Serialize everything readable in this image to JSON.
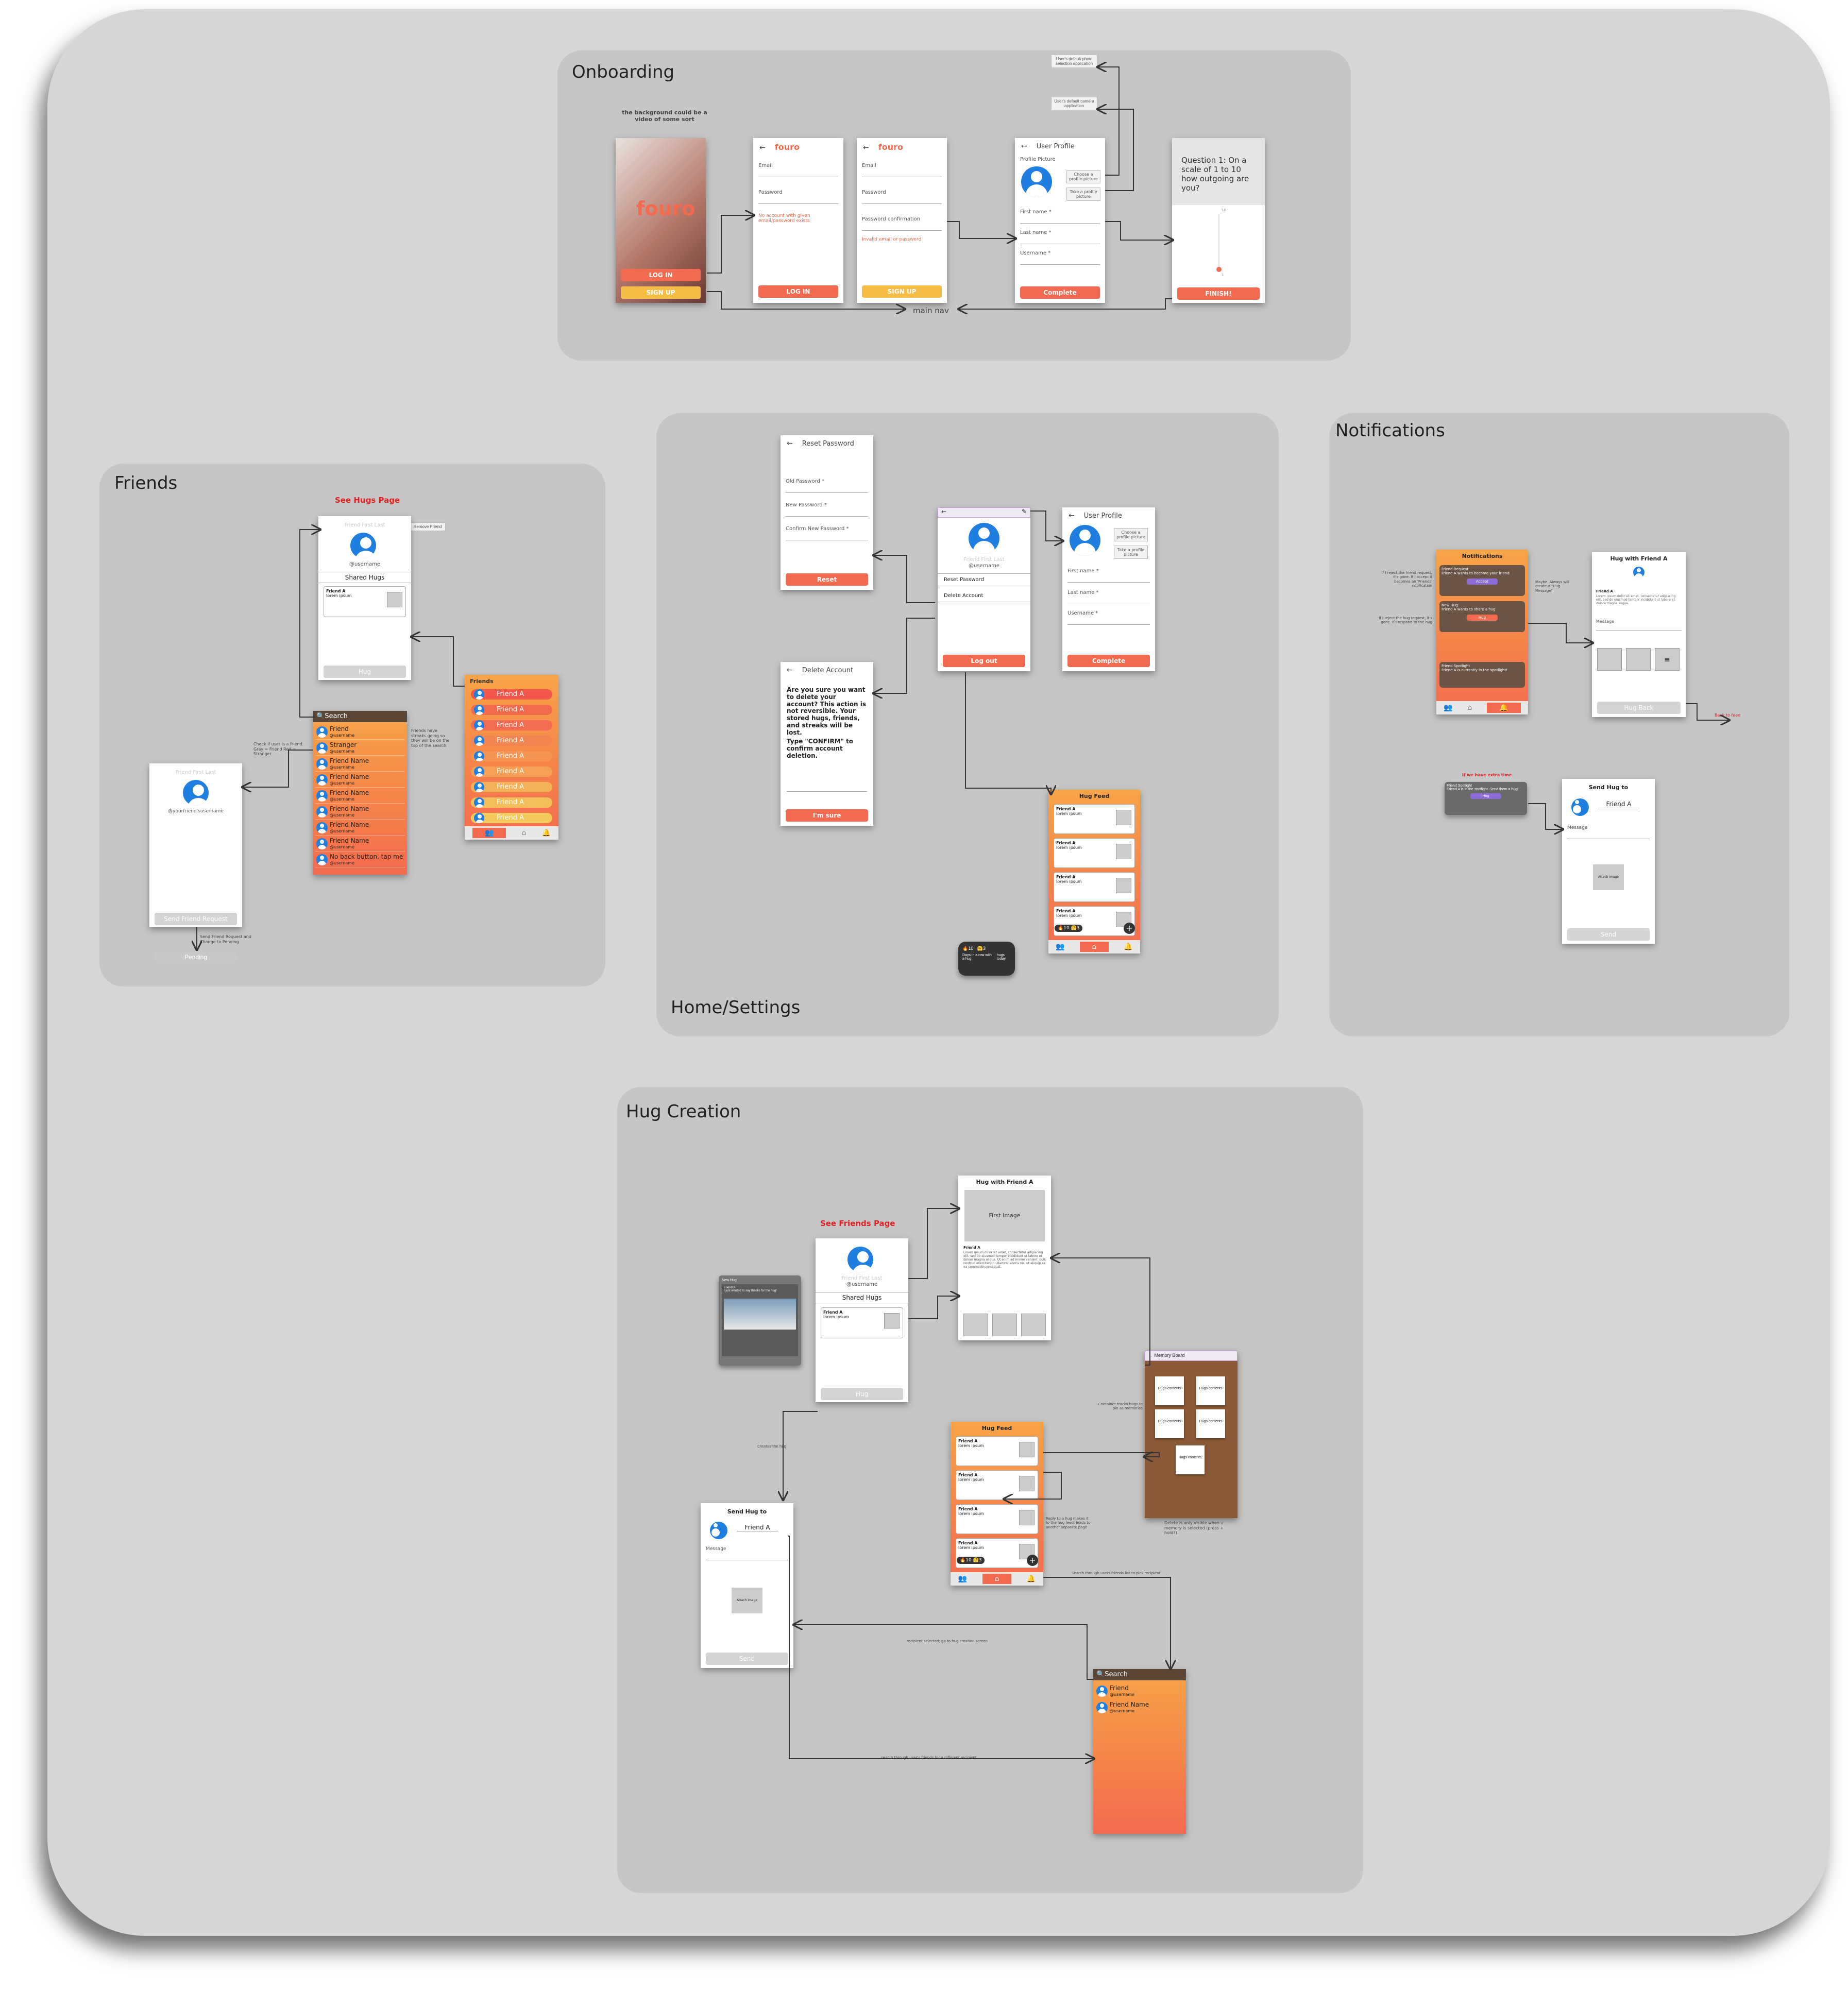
{
  "sections": {
    "onboarding": "Onboarding",
    "friends": "Friends",
    "home_settings": "Home/Settings",
    "notifications": "Notifications",
    "hug_creation": "Hug Creation"
  },
  "onboarding": {
    "bg_note": "the background could be a video of some sort",
    "splash_logo": "fouro",
    "splash_login": "LOG IN",
    "splash_signup": "SIGN UP",
    "login": {
      "logo": "fouro",
      "email": "Email",
      "password": "Password",
      "error": "No account with given email/password exists",
      "button": "LOG IN"
    },
    "signup": {
      "logo": "fouro",
      "email": "Email",
      "password": "Password",
      "confirm": "Password confirmation",
      "error": "Invalid email or password",
      "button": "SIGN UP"
    },
    "profile": {
      "title": "User Profile",
      "picture": "Profile Picture",
      "choose": "Choose a profile picture",
      "take": "Take a profile picture",
      "first": "First name *",
      "last": "Last name *",
      "username": "Username *",
      "button": "Complete"
    },
    "tag_gallery": "User's default photo selection application",
    "tag_camera": "User's default camera application",
    "question": {
      "text": "Question 1: On a scale of 1 to 10 how outgoing are you?",
      "button": "FINISH!",
      "scale_top": "10",
      "scale_bottom": "1"
    },
    "main_nav": "main nav"
  },
  "friends": {
    "see_hugs": "See Hugs Page",
    "remove_friend": "Remove Friend",
    "profile": {
      "name": "Friend First Last",
      "username": "@username",
      "shared": "Shared Hugs",
      "hug_name": "Friend A",
      "hug_text": "lorem ipsum",
      "button": "Hug"
    },
    "search": {
      "placeholder": "Search",
      "rows": [
        {
          "name": "Friend",
          "user": "@username"
        },
        {
          "name": "Stranger",
          "user": "@username"
        },
        {
          "name": "Friend Name",
          "user": "@username"
        },
        {
          "name": "Friend Name",
          "user": "@username"
        },
        {
          "name": "Friend Name",
          "user": "@username"
        },
        {
          "name": "Friend Name",
          "user": "@username"
        },
        {
          "name": "Friend Name",
          "user": "@username"
        },
        {
          "name": "Friend Name",
          "user": "@username"
        },
        {
          "name": "No back button, tap me",
          "user": "@username"
        }
      ]
    },
    "list": {
      "title": "Friends",
      "items": [
        "Friend A",
        "Friend A",
        "Friend A",
        "Friend A",
        "Friend A",
        "Friend A",
        "Friend A",
        "Friend A",
        "Friend A"
      ]
    },
    "stranger": {
      "name": "Friend First Last",
      "username": "@yourfriend'susername",
      "button": "Send Friend Request",
      "pending": "Pending"
    },
    "note_stranger": "Check if user is a friend. Gray = Friend Red = Stranger",
    "note_streak": "Friends have streaks going so they will be on the top of the search",
    "note_request": "Send Friend Request and Change to Pending"
  },
  "home": {
    "reset": {
      "title": "Reset Password",
      "old": "Old Password *",
      "new": "New Password *",
      "confirm": "Confirm New Password *",
      "button": "Reset"
    },
    "delete": {
      "title": "Delete Account",
      "text": "Are you sure you want to delete your account? This action is not reversible. Your stored hugs, friends, and streaks will be lost.",
      "confirm_text": "Type \"CONFIRM\" to confirm account deletion.",
      "button": "I'm sure"
    },
    "settings": {
      "name": "Friend First Last",
      "username": "@username",
      "reset": "Reset Password",
      "delete": "Delete Account",
      "button": "Log out"
    },
    "edit_profile": {
      "title": "User Profile",
      "choose": "Choose a profile picture",
      "take": "Take a profile picture",
      "first": "First name *",
      "last": "Last name *",
      "username": "Username *",
      "button": "Complete"
    },
    "feed": {
      "title": "Hug Feed",
      "items": [
        {
          "name": "Friend A",
          "text": "lorem ipsum"
        },
        {
          "name": "Friend A",
          "text": "lorem ipsum"
        },
        {
          "name": "Friend A",
          "text": "lorem ipsum"
        },
        {
          "name": "Friend A",
          "text": "lorem ipsum"
        }
      ],
      "streak": "10",
      "hugs": "3"
    },
    "tooltip": {
      "streak": "10",
      "hugs": "3",
      "streak_label": "Days in a row with a hug",
      "hugs_label": "hugs today"
    }
  },
  "notifications": {
    "panel": {
      "title": "Notifications",
      "fr_title": "Friend Request",
      "fr_text": "Friend A wants to become your friend",
      "fr_button": "Accept",
      "hug_title": "New Hug",
      "hug_text": "Friend A wants to share a hug",
      "hug_button": "Hug",
      "spot_title": "Friend Spotlight",
      "spot_text": "Friend A is currently in the spotlight!"
    },
    "hug_with": {
      "title": "Hug with Friend A",
      "label": "Friend A",
      "body": "Lorem ipsum dolor sit amet, consectetur adipiscing elit, sed do eiusmod tempor incididunt ut labore et dolore magna aliqua.",
      "message": "Message",
      "button": "Hug Back"
    },
    "note_accept": "If I reject the friend request, it's gone. If I accept it becomes an 'Friends' notification",
    "note_hug": "If I reject the hug request, it's gone. If I respond to the hug",
    "note_message": "Maybe, Always will create a \"Hug Message\"",
    "back_to_feed": "Back to feed",
    "spotlight_note": "If we have extra time",
    "spot_card": {
      "title": "Friend Spotlight",
      "text": "Friend A is in the spotlight. Send them a hug!",
      "button": "Hug"
    },
    "send": {
      "title": "Send Hug to",
      "friend": "Friend A",
      "message": "Message",
      "image": "Attach image",
      "button": "Send"
    }
  },
  "hug_creation": {
    "see_friends": "See Friends Page",
    "new_hug": {
      "title": "New Hug",
      "name": "Friend A",
      "text": "I just wanted to say thanks for the hug!"
    },
    "friend_profile": {
      "name": "Friend First Last",
      "username": "@username",
      "shared": "Shared Hugs",
      "hug_name": "Friend A",
      "hug_text": "lorem ipsum",
      "button": "Hug"
    },
    "hug_view": {
      "title": "Hug with Friend A",
      "image": "First Image",
      "label": "Friend A",
      "body": "Lorem ipsum dolor sit amet, consectetur adipiscing elit, sed do eiusmod tempor incididunt ut labore et dolore magna aliqua. Ut enim ad minim veniam, quis nostrud exercitation ullamco laboris nisi ut aliquip ex ea commodo consequat."
    },
    "memory": {
      "title": "Memory Board",
      "items": [
        "Hugs contents",
        "Hugs contents",
        "Hugs contents",
        "Hugs contents",
        "Hugs contents"
      ],
      "note": "Delete is only visible when a memory is selected (press + hold?)"
    },
    "feed": {
      "title": "Hug Feed",
      "items": [
        {
          "name": "Friend A",
          "text": "lorem ipsum"
        },
        {
          "name": "Friend A",
          "text": "lorem ipsum"
        },
        {
          "name": "Friend A",
          "text": "lorem ipsum"
        },
        {
          "name": "Friend A",
          "text": "lorem ipsum"
        }
      ],
      "streak": "10",
      "hugs": "3"
    },
    "send": {
      "title": "Send Hug to",
      "friend": "Friend A",
      "message": "Message",
      "image": "Attach image",
      "button": "Send"
    },
    "search": {
      "placeholder": "Search",
      "rows": [
        {
          "name": "Friend",
          "user": "@username"
        },
        {
          "name": "Friend Name",
          "user": "@username"
        }
      ]
    },
    "note_creates": "Creates the hug",
    "note_pinned": "Container tracks hugs to pin as memories",
    "note_reply": "Reply to a hug makes it to the hug feed; leads to another separate page",
    "note_search_feed": "Search through users friends list to pick recipient",
    "note_recipient": "recipient selected; go to hug creation screen",
    "note_search_diff": "search through user's friends for a different recipient"
  }
}
